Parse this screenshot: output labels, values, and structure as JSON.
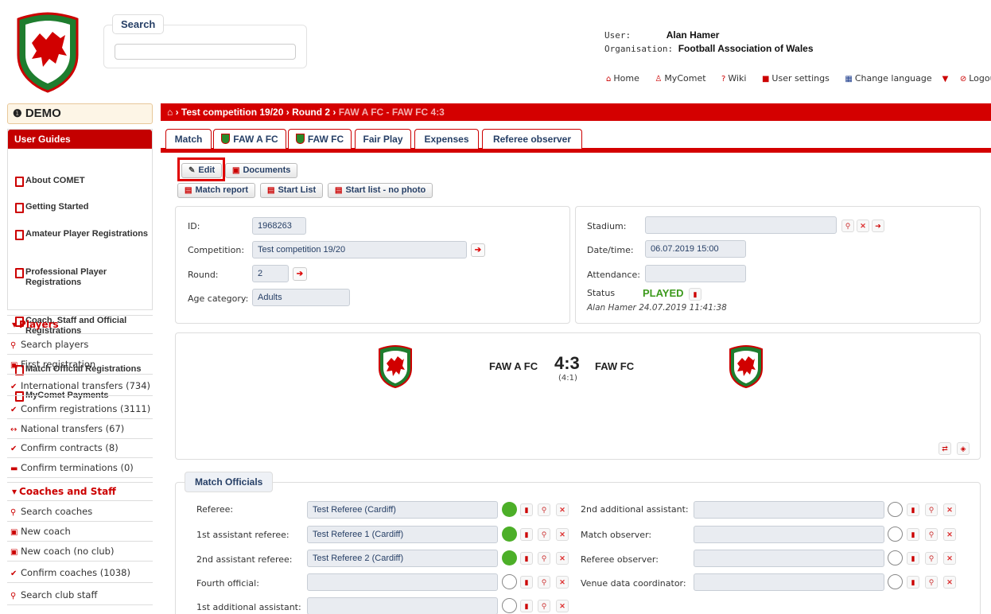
{
  "header": {
    "search_label": "Search",
    "search_placeholder": "",
    "user_label": "User:",
    "user_name": "Alan Hamer",
    "org_label": "Organisation:",
    "org_name": "Football Association of Wales",
    "nav": [
      {
        "icon": "home-icon",
        "label": "Home"
      },
      {
        "icon": "user-icon",
        "label": "MyComet"
      },
      {
        "icon": "help-icon",
        "label": "Wiki"
      },
      {
        "icon": "settings-icon",
        "label": "User settings"
      },
      {
        "icon": "flag-icon",
        "label": "Change language"
      },
      {
        "icon": "power-icon",
        "label": "Logout"
      }
    ]
  },
  "sidebar": {
    "demo": "DEMO",
    "guides_title": "User Guides",
    "guides": [
      "About COMET",
      "Getting Started",
      "Amateur Player Registrations",
      "Professional Player Registrations",
      "Coach, Staff and Official Registrations",
      "Match Official Registrations",
      "MyComet Payments"
    ],
    "players_title": "Players",
    "players": [
      {
        "icon": "search-icon",
        "label": "Search players"
      },
      {
        "icon": "document-icon",
        "label": "First registration"
      },
      {
        "icon": "check-icon",
        "label": "International transfers (734)"
      },
      {
        "icon": "check-icon",
        "label": "Confirm registrations (3111)"
      },
      {
        "icon": "transfer-icon",
        "label": "National transfers (67)"
      },
      {
        "icon": "check-icon",
        "label": "Confirm contracts (8)"
      },
      {
        "icon": "trash-icon",
        "label": "Confirm terminations (0)"
      }
    ],
    "coaches_title": "Coaches and Staff",
    "coaches": [
      {
        "icon": "search-icon",
        "label": "Search coaches"
      },
      {
        "icon": "document-icon",
        "label": "New coach"
      },
      {
        "icon": "document-icon",
        "label": "New coach (no club)"
      },
      {
        "icon": "check-icon",
        "label": "Confirm coaches (1038)"
      },
      {
        "icon": "search-icon",
        "label": "Search club staff"
      }
    ]
  },
  "breadcrumb": {
    "part1": "Test competition 19/20",
    "part2": "Round 2",
    "part3": "FAW A FC - FAW FC 4:3"
  },
  "tabs": [
    "Match",
    "FAW A FC",
    "FAW FC",
    "Fair Play",
    "Expenses",
    "Referee observer"
  ],
  "actions": {
    "edit": "Edit",
    "documents": "Documents",
    "match_report": "Match report",
    "start_list": "Start List",
    "start_list_nophoto": "Start list - no photo"
  },
  "match": {
    "id_label": "ID:",
    "id": "1968263",
    "competition_label": "Competition:",
    "competition": "Test competition 19/20",
    "round_label": "Round:",
    "round": "2",
    "age_label": "Age category:",
    "age": "Adults",
    "stadium_label": "Stadium:",
    "stadium": "",
    "datetime_label": "Date/time:",
    "datetime": "06.07.2019 15:00",
    "attendance_label": "Attendance:",
    "attendance": "",
    "status_label": "Status",
    "status": "PLAYED",
    "status_by": "Alan Hamer 24.07.2019 11:41:38"
  },
  "score": {
    "home": "FAW A FC",
    "away": "FAW FC",
    "result": "4:3",
    "halftime": "(4:1)"
  },
  "officials": {
    "title": "Match Officials",
    "left": [
      {
        "label": "Referee:",
        "value": "Test Referee (Cardiff)",
        "confirmed": true
      },
      {
        "label": "1st assistant referee:",
        "value": "Test Referee 1 (Cardiff)",
        "confirmed": true
      },
      {
        "label": "2nd assistant referee:",
        "value": "Test Referee 2 (Cardiff)",
        "confirmed": true
      },
      {
        "label": "Fourth official:",
        "value": "",
        "confirmed": false
      },
      {
        "label": "1st additional assistant:",
        "value": "",
        "confirmed": false
      }
    ],
    "right": [
      {
        "label": "2nd additional assistant:",
        "value": "",
        "confirmed": false
      },
      {
        "label": "Match observer:",
        "value": "",
        "confirmed": false
      },
      {
        "label": "Referee observer:",
        "value": "",
        "confirmed": false
      },
      {
        "label": "Venue data coordinator:",
        "value": "",
        "confirmed": false
      }
    ]
  },
  "colors": {
    "brand": "#d40000",
    "accent_green": "#4caf28",
    "link_navy": "#263f66"
  }
}
